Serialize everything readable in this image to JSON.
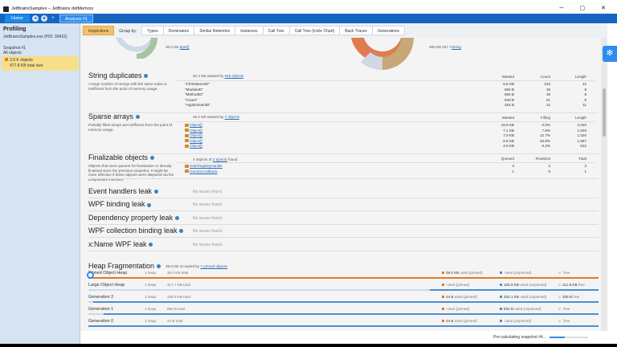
{
  "window": {
    "title": "JetBrainsSamples – JetBrains dotMemory",
    "minimize": "─",
    "maximize": "▢",
    "close": "✕"
  },
  "nav": {
    "home_tab": "Home",
    "analysis_tab": "Analysis #1"
  },
  "sidebar": {
    "title": "Profiling",
    "process": "JetBrainsSamples.exe (PID: 39416)",
    "snapshot_name": "Snapshot #1",
    "snapshot_scope": "All objects",
    "card_objects": "3.9 K objects",
    "card_size": "477.8 KB total size"
  },
  "tabs": [
    {
      "label": "Inspections",
      "active": true
    },
    {
      "label": "Group by:",
      "is_label": true
    },
    {
      "label": "Types"
    },
    {
      "label": "Dominators"
    },
    {
      "label": "Similar Retention"
    },
    {
      "label": "Instances"
    },
    {
      "label": "Call Tree"
    },
    {
      "label": "Call Tree (Icicle Chart)"
    },
    {
      "label": "Back Traces"
    },
    {
      "label": "Generations"
    }
  ],
  "top_fragment": {
    "left_size": "36.0 KB",
    "left_link": "Byte[]",
    "right_size": "360 KB",
    "right_count": "157 ×",
    "right_link": "String"
  },
  "string_duplicates": {
    "title": "String duplicates",
    "desc": "A large number of strings with the same value is inefficient from the point of memory usage.",
    "summary_pre": "20.4 KB wasted by",
    "summary_link": "546 objects",
    "headers": [
      "Wasted",
      "Count",
      "Length"
    ],
    "rows": [
      {
        "name": "\"ClrInstanceID\"",
        "wasted": "5.6 KB",
        "count": "120",
        "length": "13"
      },
      {
        "name": "\"ModuleID\"",
        "wasted": "684 B",
        "count": "19",
        "length": "8"
      },
      {
        "name": "\"MethodID\"",
        "wasted": "684 B",
        "count": "19",
        "length": "8"
      },
      {
        "name": "\"Count\"",
        "wasted": "640 B",
        "count": "21",
        "length": "5"
      },
      {
        "name": "\"AppDomainID\"",
        "wasted": "464 B",
        "count": "12",
        "length": "11"
      }
    ]
  },
  "sparse_arrays": {
    "title": "Sparse arrays",
    "desc": "Partially filled arrays are inefficient from the point of memory usage.",
    "summary_pre": "46.2 KB wasted by",
    "summary_link": "7 objects",
    "headers": [
      "Wasted",
      "Filling",
      "Length"
    ],
    "rows": [
      {
        "name": "Object[]",
        "wasted": "15.9 KB",
        "filling": "0.0%",
        "length": "2,040"
      },
      {
        "name": "Object[]",
        "wasted": "7.1 KB",
        "filling": "7.8%",
        "length": "1,020"
      },
      {
        "name": "Object[]",
        "wasted": "7.0 KB",
        "filling": "12.7%",
        "length": "1,020"
      },
      {
        "name": "Object[]",
        "wasted": "6.6 KB",
        "filling": "46.8%",
        "length": "1,597"
      },
      {
        "name": "Object[]",
        "wasted": "4.0 KB",
        "filling": "0.2%",
        "length": "512"
      }
    ]
  },
  "finalizable": {
    "title": "Finalizable objects",
    "desc": "Objects that were queued for finalization or already finalized since the previous snapshot. It might be more effective if these objects were disposed via the IDisposable interface.",
    "summary_pre": "4 objects of",
    "summary_link": "2 type(s)",
    "summary_post": "found",
    "headers": [
      "Queued",
      "Finalized",
      "Total"
    ],
    "rows": [
      {
        "name": "SafeRegistryHandle",
        "queued": "0",
        "finalized": "3",
        "total": "3"
      },
      {
        "name": "Gen2GcCallback",
        "queued": "1",
        "finalized": "0",
        "total": "1"
      }
    ]
  },
  "no_issue_sections": [
    {
      "title": "Event handlers leak",
      "status": "No issues found."
    },
    {
      "title": "WPF binding leak",
      "status": "No issues found."
    },
    {
      "title": "Dependency property leak",
      "status": "No issues found."
    },
    {
      "title": "WPF collection binding leak",
      "status": "No issues found."
    },
    {
      "title": "x:Name WPF leak",
      "status": "No issues found."
    }
  ],
  "heap": {
    "title": "Heap Fragmentation",
    "summary_pre": "39.0 KB occupied by",
    "summary_link": "7 pinned objects",
    "rows": [
      {
        "name": "Pinned Object Heap",
        "heaps": "1 heap",
        "total": "36.0 KB total",
        "a_val": "39.0 KB",
        "a_label": "used (pinned)",
        "a_color": "#e07b20",
        "b_val": "",
        "b_label": "used (unpinned)",
        "c_val": "",
        "c_label": "free",
        "used_frac": 1.0,
        "unp_frac": 0.0
      },
      {
        "name": "Large Object Heap",
        "heaps": "1 heap",
        "total": "317.7 KB total",
        "a_val": "",
        "a_label": "used (pinned)",
        "a_color": "#e07b20",
        "b_val": "105.9 KB",
        "b_label": "used (unpinned)",
        "c_val": "211.8 KB",
        "c_label": "free",
        "used_frac": 0.0,
        "unp_frac": 0.33
      },
      {
        "name": "Generation 2",
        "heaps": "1 heap",
        "total": "335.9 KB total",
        "a_val": "24 B",
        "a_label": "used (pinned)",
        "a_color": "#e07b20",
        "b_val": "332.1 KB",
        "b_label": "used (unpinned)",
        "c_val": "336 B",
        "c_label": "free",
        "used_frac": 0.0,
        "unp_frac": 0.99
      },
      {
        "name": "Generation 1",
        "heaps": "1 heap",
        "total": "856 B total",
        "a_val": "",
        "a_label": "used (pinned)",
        "a_color": "#e07b20",
        "b_val": "832 B",
        "b_label": "used (unpinned)",
        "c_val": "",
        "c_label": "free",
        "used_frac": 0.0,
        "unp_frac": 0.97
      },
      {
        "name": "Generation 0",
        "heaps": "1 heap",
        "total": "24 B total",
        "a_val": "24 B",
        "a_label": "used (pinned)",
        "a_color": "#e07b20",
        "b_val": "",
        "b_label": "used (unpinned)",
        "c_val": "",
        "c_label": "free",
        "used_frac": 0.0,
        "unp_frac": 1.0
      }
    ]
  },
  "status": {
    "text": "Pre-calculating snapshot #4...",
    "progress": 0.4
  },
  "colors": {
    "accent": "#2d8cf0",
    "pinned": "#e07b20",
    "unpinned": "#4a8fd6",
    "free": "#cfd8e3"
  }
}
